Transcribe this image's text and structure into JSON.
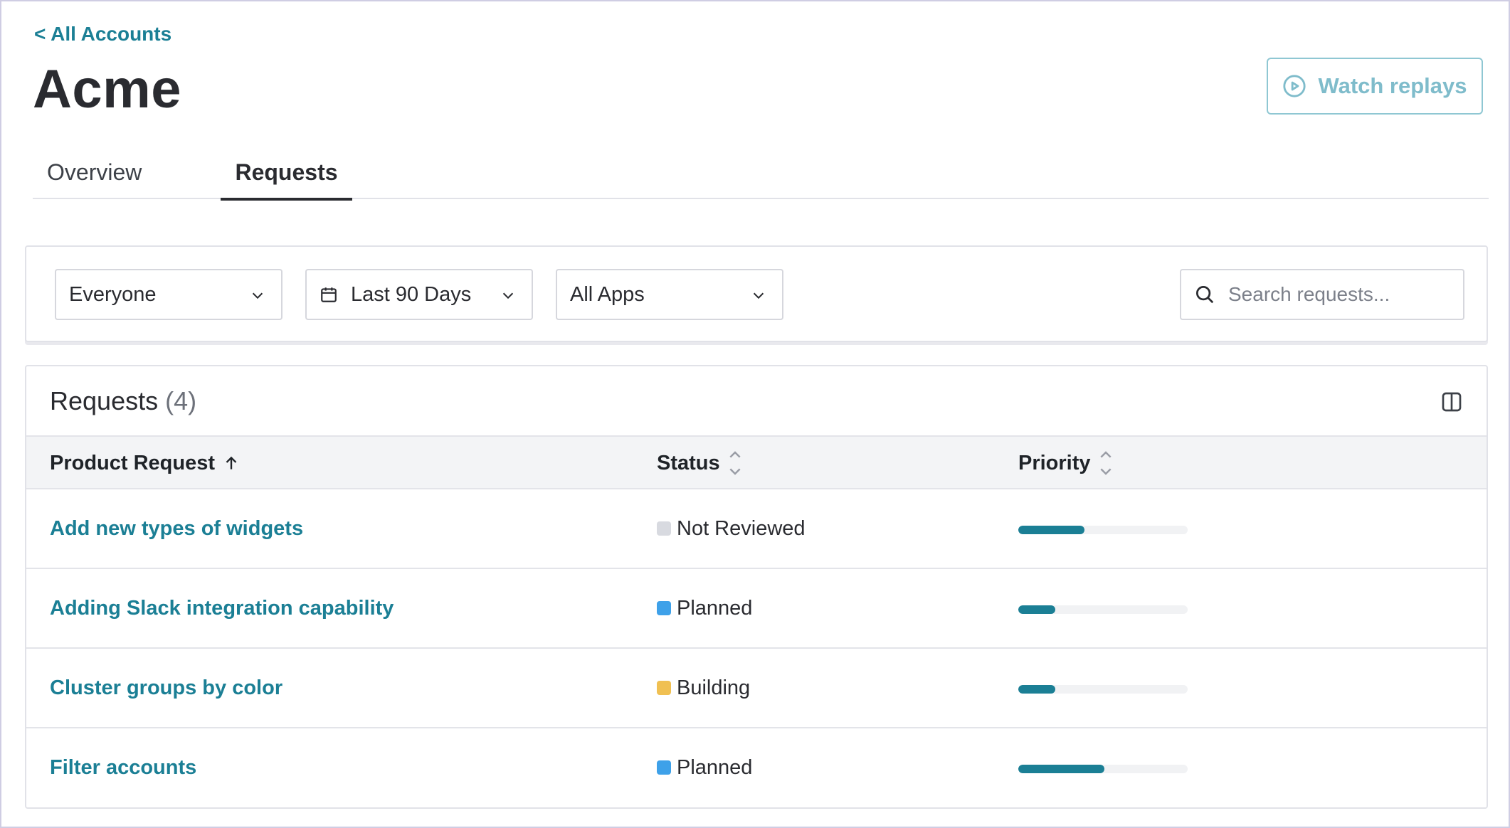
{
  "header": {
    "back_label": "< All Accounts",
    "title": "Acme",
    "watch_label": "Watch replays"
  },
  "tabs": [
    {
      "label": "Overview",
      "active": false
    },
    {
      "label": "Requests",
      "active": true
    }
  ],
  "filters": {
    "audience": "Everyone",
    "date_range": "Last 90 Days",
    "apps": "All Apps",
    "search_placeholder": "Search requests..."
  },
  "table": {
    "title": "Requests",
    "count": "(4)",
    "columns": {
      "request": "Product Request",
      "status": "Status",
      "priority": "Priority"
    },
    "rows": [
      {
        "request": "Add new types of widgets",
        "status": "Not Reviewed",
        "status_color": "#d8dae0",
        "priority": 0.39
      },
      {
        "request": "Adding Slack integration capability",
        "status": "Planned",
        "status_color": "#3ea1e9",
        "priority": 0.22
      },
      {
        "request": "Cluster groups by color",
        "status": "Building",
        "status_color": "#f0c052",
        "priority": 0.22
      },
      {
        "request": "Filter accounts",
        "status": "Planned",
        "status_color": "#3ea1e9",
        "priority": 0.51
      }
    ]
  },
  "colors": {
    "accent": "#1b7f95",
    "watch_button": "#7fbccb"
  }
}
